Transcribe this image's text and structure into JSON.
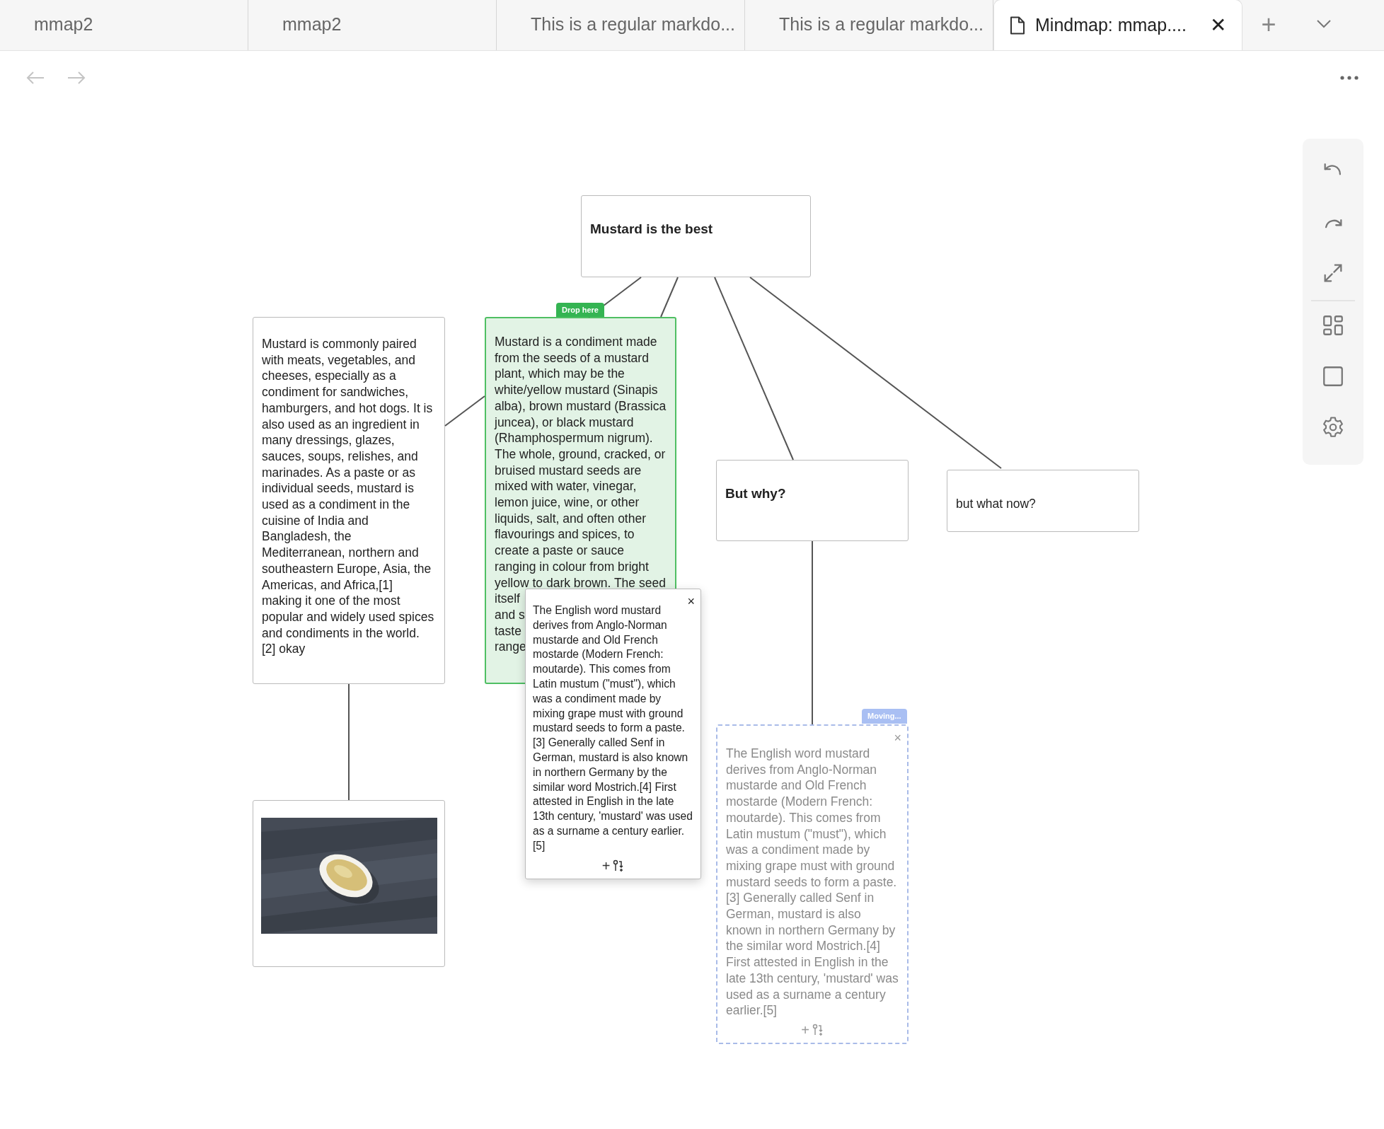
{
  "tabs": [
    {
      "label": "mmap2",
      "selected": false
    },
    {
      "label": "mmap2",
      "selected": false
    },
    {
      "label": "This is a regular markdo...",
      "selected": false
    },
    {
      "label": "This is a regular markdo...",
      "selected": false
    },
    {
      "label": "Mindmap: mmap....",
      "selected": true,
      "close": "✕"
    }
  ],
  "new_tab": "+",
  "mindmap": {
    "root": {
      "text": "Mustard is the best",
      "bold": true,
      "children": [
        {
          "text": "Mustard is commonly paired with meats, vegetables, and cheeses, especially as a condiment for sandwiches, hamburgers, and hot dogs. It is also used as an ingredient in many dressings, glazes, sauces, soups, relishes, and marinades. As a paste or as individual seeds, mustard is used as a condiment in the cuisine of India and Bangladesh, the Mediterranean, northern and southeastern Europe, Asia, the Americas, and Africa,[1] making it one of the most popular and widely used spices and condiments in the world. [2] okay",
          "bold": false
        },
        {
          "text": "Mustard is a condiment made from the seeds of a mustard plant, which may be the white/yellow mustard (Sinapis alba), brown mustard (Brassica juncea), or black mustard (Rhamphospermum nigrum). The whole, ground, cracked, or bruised mustard seeds are mixed with water, vinegar, lemon juice, wine, or other liquids, salt, and often other flavourings and spices, to create a paste or sauce ranging in colour from bright yellow to dark brown. The seed",
          "covered_lines": [
            "itself",
            "and s",
            "taste",
            "range"
          ],
          "bold": false,
          "drop_target": true,
          "badge": "Drop here"
        },
        {
          "text": "But why?",
          "bold": true,
          "children": [
            {
              "text": "The English word mustard derives from Anglo-Norman mustarde and Old French mostarde (Modern French: moutarde). This comes from Latin mustum (\"must\"), which was a condiment made by mixing grape must with ground mustard seeds to form a paste.[3] Generally called Senf in German, mustard is also known in northern Germany by the similar word Mostrich.[4] First attested in English in the late 13th century, 'mustard' was used as a surname a century earlier.[5]",
              "bold": false,
              "moving": true,
              "badge": "Moving...",
              "close": "×",
              "add": "+"
            }
          ]
        },
        {
          "text": "but what now?",
          "bold": false
        }
      ]
    }
  },
  "dragged_card": {
    "text": "The English word mustard derives from Anglo-Norman mustarde and Old French mostarde (Modern French: moutarde). This comes from Latin mustum (\"must\"), which was a condiment made by mixing grape must with ground mustard seeds to form a paste.[3] Generally called Senf in German, mustard is also known in northern Germany by the similar word Mostrich.[4] First attested in English in the late 13th century, 'mustard' was used as a surname a century earlier.[5]",
    "close": "×",
    "add": "+"
  }
}
